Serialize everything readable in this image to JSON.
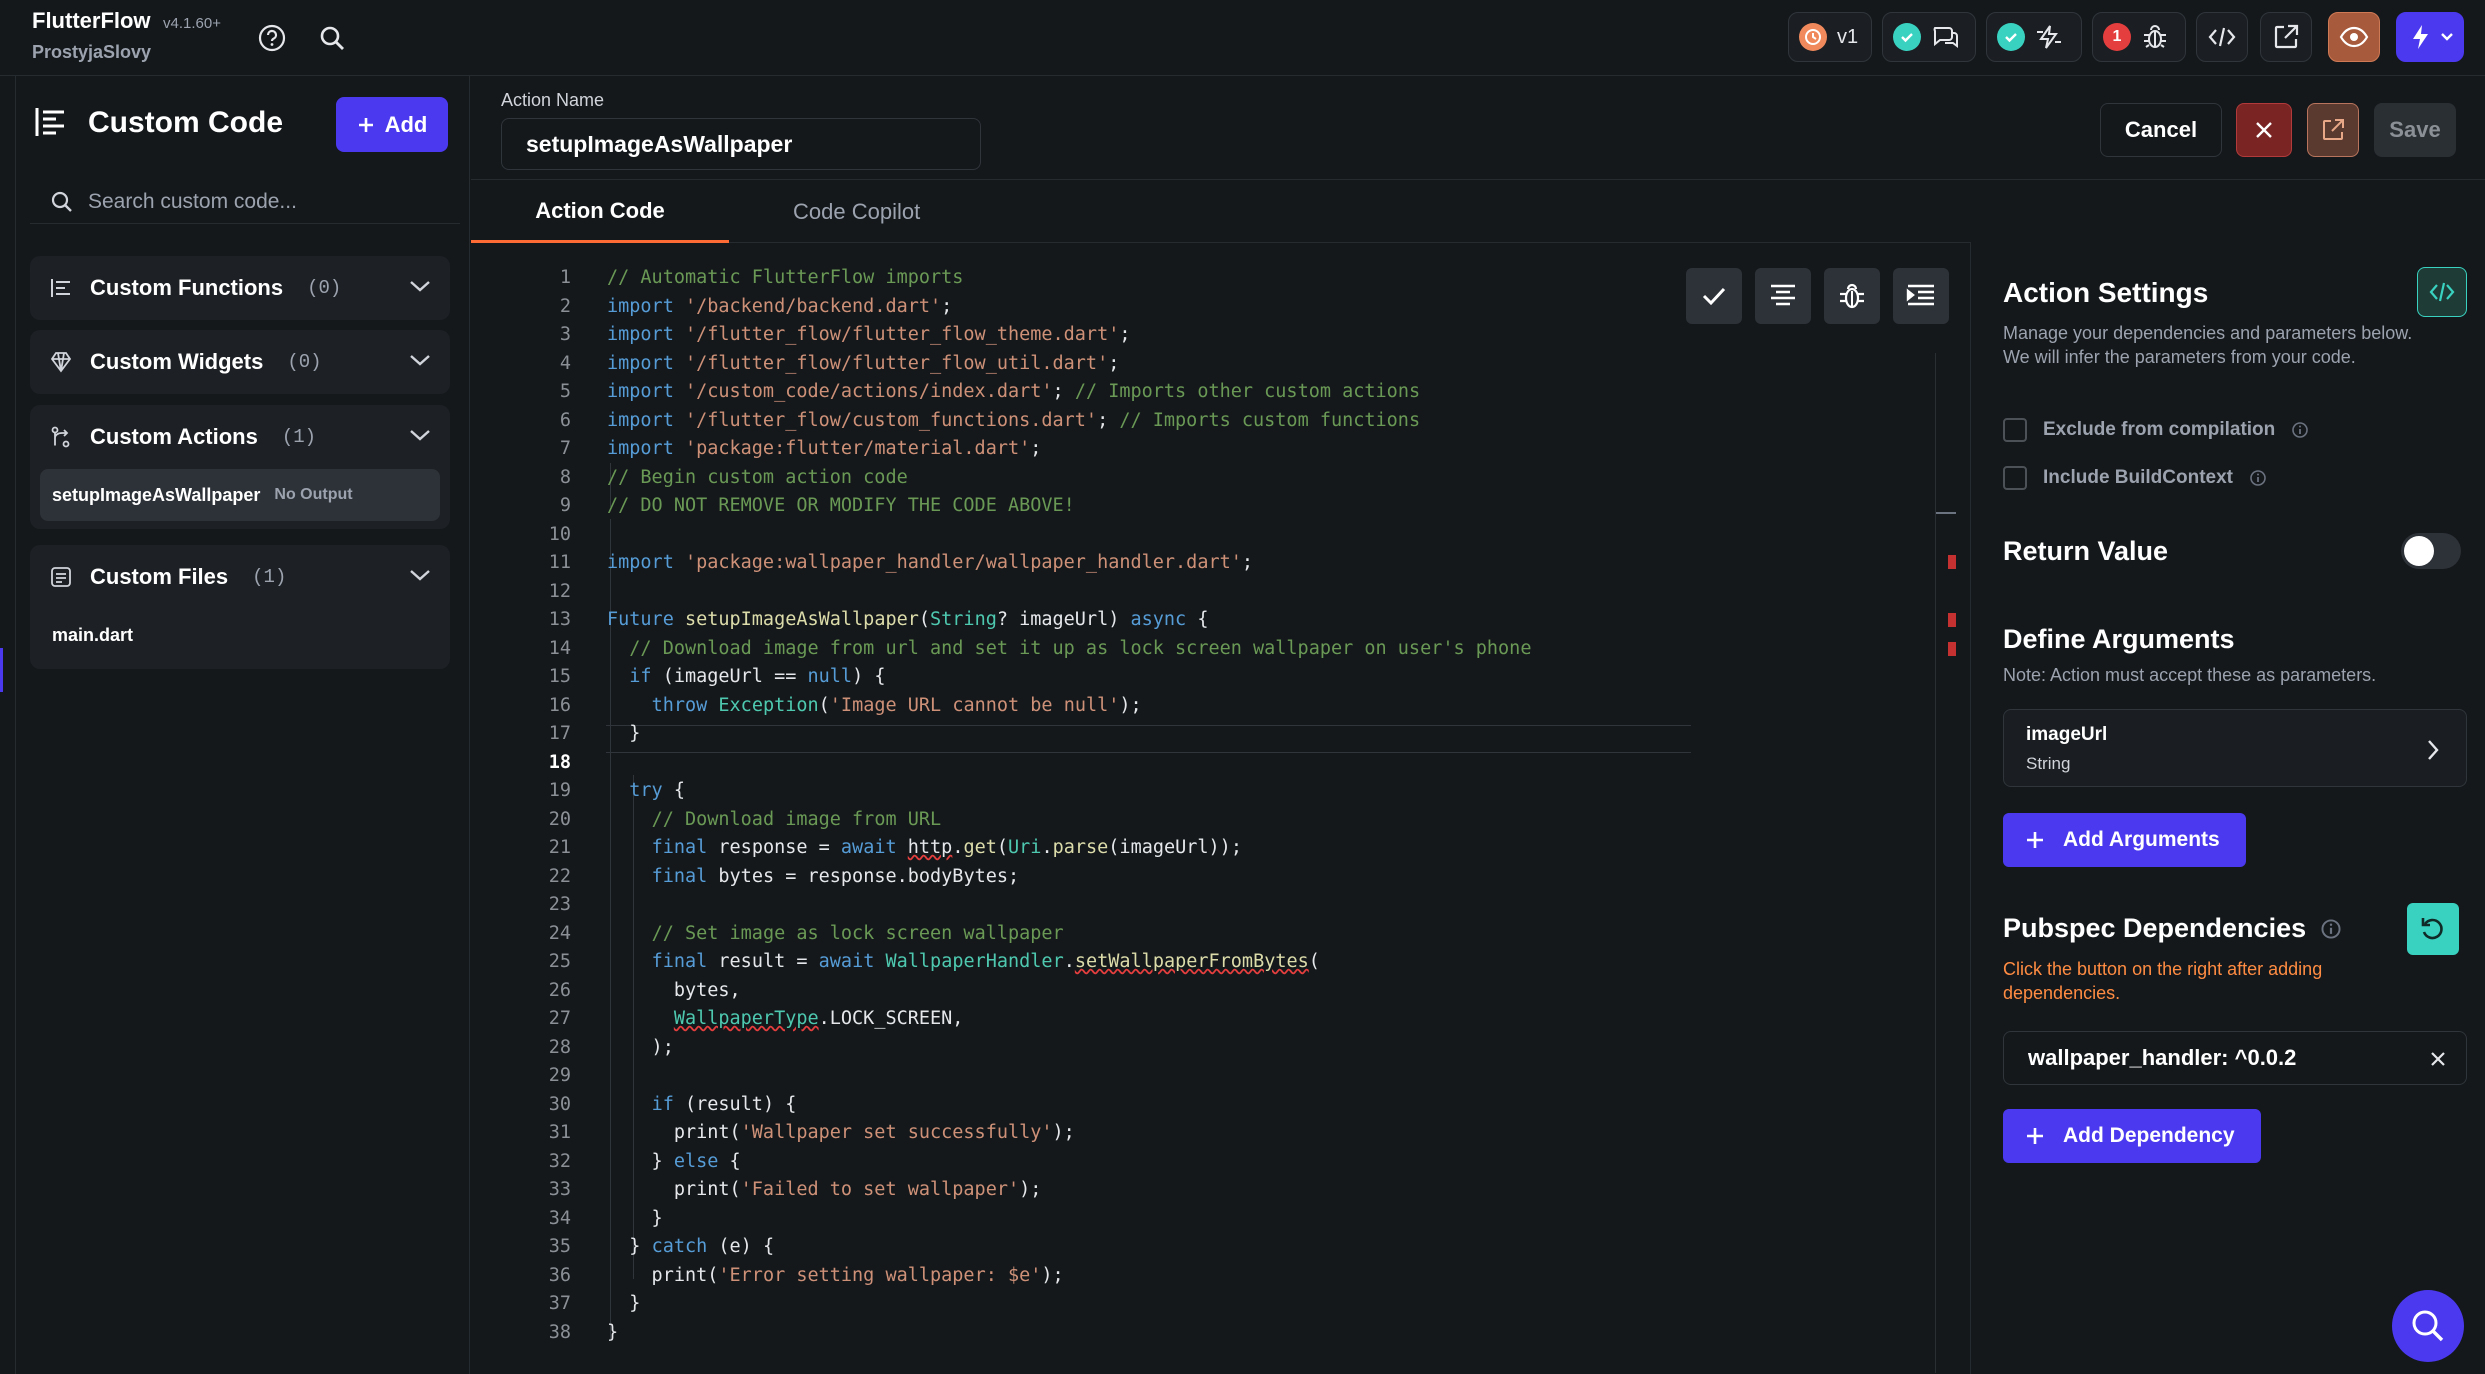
{
  "app": {
    "name": "FlutterFlow",
    "version": "v4.1.60+",
    "project": "ProstyjaSlovy"
  },
  "topbar": {
    "version_badge": "v1",
    "bug_count": "1"
  },
  "sidebar": {
    "title": "Custom Code",
    "add_label": "Add",
    "search_placeholder": "Search custom code...",
    "sections": [
      {
        "label": "Custom Functions",
        "count": "(0)",
        "items": []
      },
      {
        "label": "Custom Widgets",
        "count": "(0)",
        "items": []
      },
      {
        "label": "Custom Actions",
        "count": "(1)",
        "items": [
          {
            "name": "setupImageAsWallpaper",
            "tag": "No Output"
          }
        ]
      },
      {
        "label": "Custom Files",
        "count": "(1)",
        "items": [
          {
            "name": "main.dart",
            "tag": ""
          }
        ]
      }
    ]
  },
  "header": {
    "action_name_label": "Action Name",
    "action_name_value": "setupImageAsWallpaper",
    "cancel_label": "Cancel",
    "save_label": "Save"
  },
  "tabs": [
    {
      "label": "Action Code"
    },
    {
      "label": "Code Copilot"
    }
  ],
  "editor": {
    "current_line": 18,
    "lines": [
      "// Automatic FlutterFlow imports",
      "import '/backend/backend.dart';",
      "import '/flutter_flow/flutter_flow_theme.dart';",
      "import '/flutter_flow/flutter_flow_util.dart';",
      "import '/custom_code/actions/index.dart'; // Imports other custom actions",
      "import '/flutter_flow/custom_functions.dart'; // Imports custom functions",
      "import 'package:flutter/material.dart';",
      "// Begin custom action code",
      "// DO NOT REMOVE OR MODIFY THE CODE ABOVE!",
      "",
      "import 'package:wallpaper_handler/wallpaper_handler.dart';",
      "",
      "Future setupImageAsWallpaper(String? imageUrl) async {",
      "  // Download image from url and set it up as lock screen wallpaper on user's phone",
      "  if (imageUrl == null) {",
      "    throw Exception('Image URL cannot be null');",
      "  }",
      "",
      "  try {",
      "    // Download image from URL",
      "    final response = await http.get(Uri.parse(imageUrl));",
      "    final bytes = response.bodyBytes;",
      "",
      "    // Set image as lock screen wallpaper",
      "    final result = await WallpaperHandler.setWallpaperFromBytes(",
      "      bytes,",
      "      WallpaperType.LOCK_SCREEN,",
      "    );",
      "",
      "    if (result) {",
      "      print('Wallpaper set successfully');",
      "    } else {",
      "      print('Failed to set wallpaper');",
      "    }",
      "  } catch (e) {",
      "    print('Error setting wallpaper: $e');",
      "  }",
      "}"
    ]
  },
  "settings": {
    "title": "Action Settings",
    "description_1": "Manage your dependencies and parameters below.",
    "description_2": "We will infer the parameters from your code.",
    "exclude_label": "Exclude from compilation",
    "include_context_label": "Include BuildContext",
    "return_value_label": "Return Value",
    "return_value_enabled": false,
    "define_args_title": "Define Arguments",
    "define_args_note": "Note: Action must accept these as parameters.",
    "arguments": [
      {
        "name": "imageUrl",
        "type": "String"
      }
    ],
    "add_arguments_label": "Add Arguments",
    "pubspec_title": "Pubspec Dependencies",
    "pubspec_note": "Click the button on the right after adding dependencies.",
    "dependencies": [
      "wallpaper_handler: ^0.0.2"
    ],
    "add_dependency_label": "Add Dependency"
  },
  "colors": {
    "accent": "#4b39ef",
    "tab_underline": "#ff6b35",
    "teal": "#39d2c0",
    "warning": "#ff8c42",
    "error": "#e53e3e"
  }
}
